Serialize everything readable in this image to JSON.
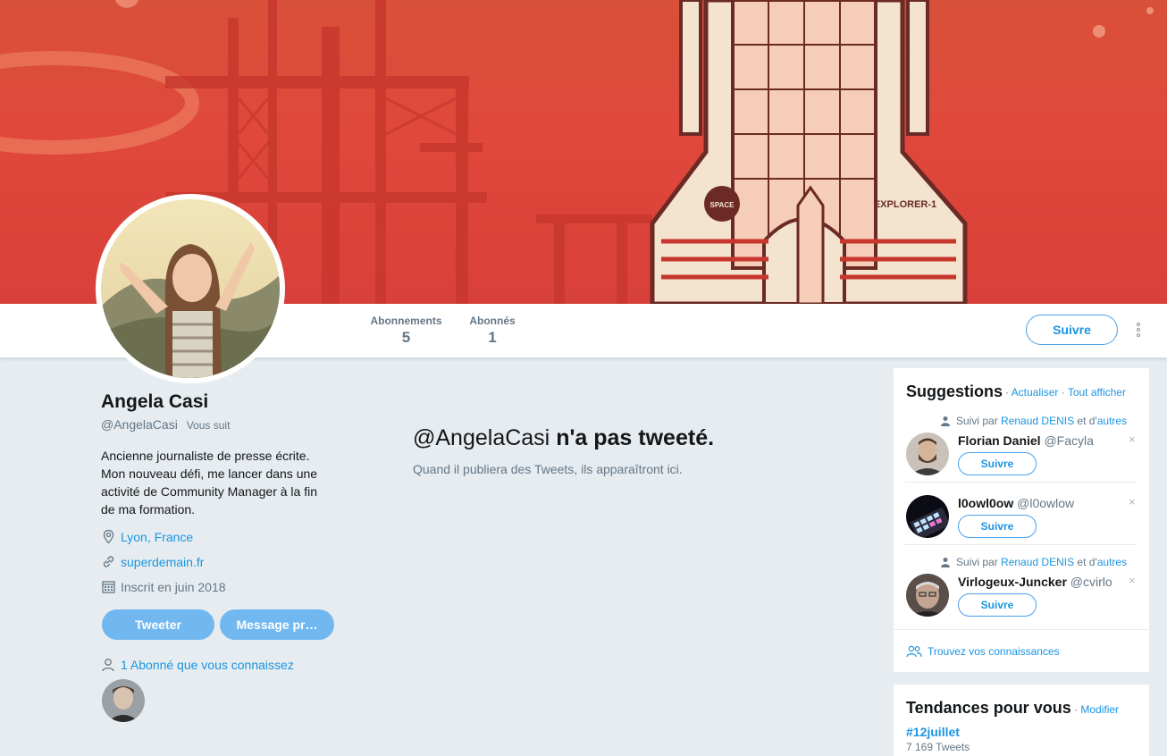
{
  "profile": {
    "name": "Angela Casi",
    "handle": "@AngelaCasi",
    "follows_you": "Vous suit",
    "bio": "Ancienne journaliste de presse écrite. Mon nouveau défi, me lancer dans une activité de Community Manager à la fin de ma formation.",
    "location": "Lyon, France",
    "website": "superdemain.fr",
    "joined": "Inscrit en juin 2018"
  },
  "stats": {
    "following_label": "Abonnements",
    "following_value": "5",
    "followers_label": "Abonnés",
    "followers_value": "1"
  },
  "actions": {
    "follow": "Suivre",
    "tweet": "Tweeter",
    "message": "Message pr…"
  },
  "known_followers": "1 Abonné que vous connaissez",
  "empty_state": {
    "handle": "@AngelaCasi",
    "title_rest": " n'a pas tweeté.",
    "subtitle": "Quand il publiera des Tweets, ils apparaîtront ici."
  },
  "suggestions": {
    "title": "Suggestions",
    "separator": " · ",
    "refresh": "Actualiser",
    "show_all": "Tout afficher",
    "followed_by": "Suivi par",
    "and_others_prefix": "et d'",
    "others": "autres",
    "items": [
      {
        "via_user": "Renaud DENIS",
        "name": "Florian Daniel",
        "handle": "@Facyla",
        "follow": "Suivre"
      },
      {
        "via_user": "",
        "name": "l0owl0ow",
        "handle": "@l0owlow",
        "follow": "Suivre"
      },
      {
        "via_user": "Renaud DENIS",
        "name": "Virlogeux-Juncker",
        "handle": "@cvirlo",
        "follow": "Suivre"
      }
    ],
    "find_friends": "Trouvez vos connaissances",
    "close_glyph": "×"
  },
  "trends": {
    "title": "Tendances pour vous",
    "separator": " · ",
    "modify": "Modifier",
    "items": [
      {
        "tag": "#12juillet",
        "count": "7 169 Tweets"
      }
    ]
  },
  "banner": {
    "text_left": "SPACE",
    "text_right": "EXPLORER-1"
  },
  "colors": {
    "accent": "#1b95e0",
    "banner": "#e0483b",
    "background": "#e6ecf0",
    "button_disabled": "#71b7f0"
  }
}
